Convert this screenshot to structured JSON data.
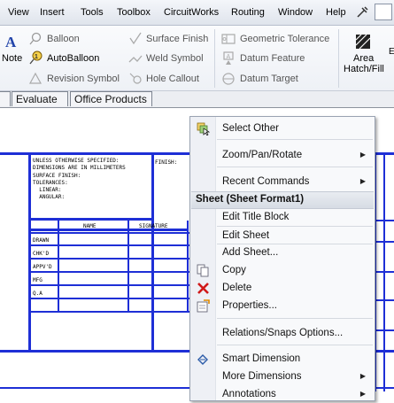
{
  "menubar": {
    "items": [
      "View",
      "Insert",
      "Tools",
      "Toolbox",
      "CircuitWorks",
      "Routing",
      "Window",
      "Help"
    ]
  },
  "toolbar": {
    "note": "Note",
    "balloon": "Balloon",
    "autoballoon": "AutoBalloon",
    "revision_symbol": "Revision Symbol",
    "surface_finish": "Surface Finish",
    "weld_symbol": "Weld Symbol",
    "hole_callout": "Hole Callout",
    "geometric_tolerance": "Geometric Tolerance",
    "datum_feature": "Datum Feature",
    "datum_target": "Datum Target",
    "area_hatch_line1": "Area",
    "area_hatch_line2": "Hatch/Fill"
  },
  "tabs": [
    "Evaluate",
    "Office Products"
  ],
  "drawing": {
    "notes_lines": [
      "UNLESS OTHERWISE SPECIFIED:",
      "DIMENSIONS ARE IN MILLIMETERS",
      "SURFACE FINISH:",
      "TOLERANCES:",
      "  LINEAR:",
      "  ANGULAR:"
    ],
    "finish_label": "FINISH:",
    "col_name": "NAME",
    "col_signature": "SIGNATURE",
    "rows": [
      "DRAWN",
      "CHK'D",
      "APPV'D",
      "MFG",
      "Q.A"
    ]
  },
  "context_menu": {
    "select_other": "Select Other",
    "zoom_pan_rotate": "Zoom/Pan/Rotate",
    "recent_commands": "Recent Commands",
    "section_title": "Sheet (Sheet Format1)",
    "edit_title_block": "Edit Title Block",
    "edit_sheet": "Edit Sheet",
    "add_sheet": "Add Sheet...",
    "copy": "Copy",
    "delete": "Delete",
    "properties": "Properties...",
    "relations_snaps": "Relations/Snaps Options...",
    "smart_dimension": "Smart Dimension",
    "more_dimensions": "More Dimensions",
    "annotations": "Annotations"
  }
}
